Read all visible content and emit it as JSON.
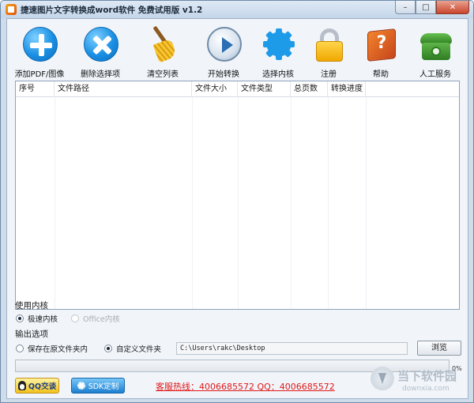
{
  "window": {
    "title": "捷速图片文字转换成word软件 免费试用版 v1.2",
    "minimize_glyph": "–",
    "maximize_glyph": "□",
    "close_glyph": "✕"
  },
  "toolbar": {
    "items": [
      {
        "label": "添加PDF/图像",
        "icon": "add-icon"
      },
      {
        "label": "删除选择项",
        "icon": "delete-icon"
      },
      {
        "label": "清空列表",
        "icon": "broom-icon"
      },
      {
        "label": "开始转换",
        "icon": "play-icon"
      },
      {
        "label": "选择内核",
        "icon": "gear-icon"
      },
      {
        "label": "注册",
        "icon": "lock-icon"
      },
      {
        "label": "帮助",
        "icon": "help-book-icon"
      },
      {
        "label": "人工服务",
        "icon": "phone-icon"
      }
    ],
    "help_glyph": "?"
  },
  "list": {
    "columns": [
      "序号",
      "文件路径",
      "文件大小",
      "文件类型",
      "总页数",
      "转换进度"
    ]
  },
  "engine": {
    "title": "使用内核",
    "options": [
      {
        "label": "极速内核",
        "selected": true,
        "enabled": true
      },
      {
        "label": "Office内核",
        "selected": false,
        "enabled": false
      }
    ]
  },
  "output": {
    "title": "输出选项",
    "options": [
      {
        "label": "保存在原文件夹内",
        "selected": false
      },
      {
        "label": "自定义文件夹",
        "selected": true
      }
    ],
    "path": "C:\\Users\\rakc\\Desktop",
    "browse_label": "浏览"
  },
  "progress": {
    "value": 0,
    "label": "0%"
  },
  "footer": {
    "qq_label": "QQ交谈",
    "sdk_label": "SDK定制",
    "hotline": "客服热线：4006685572 QQ：4006685572"
  },
  "watermark": {
    "text": "当下软件园",
    "url": "downxia.com"
  }
}
